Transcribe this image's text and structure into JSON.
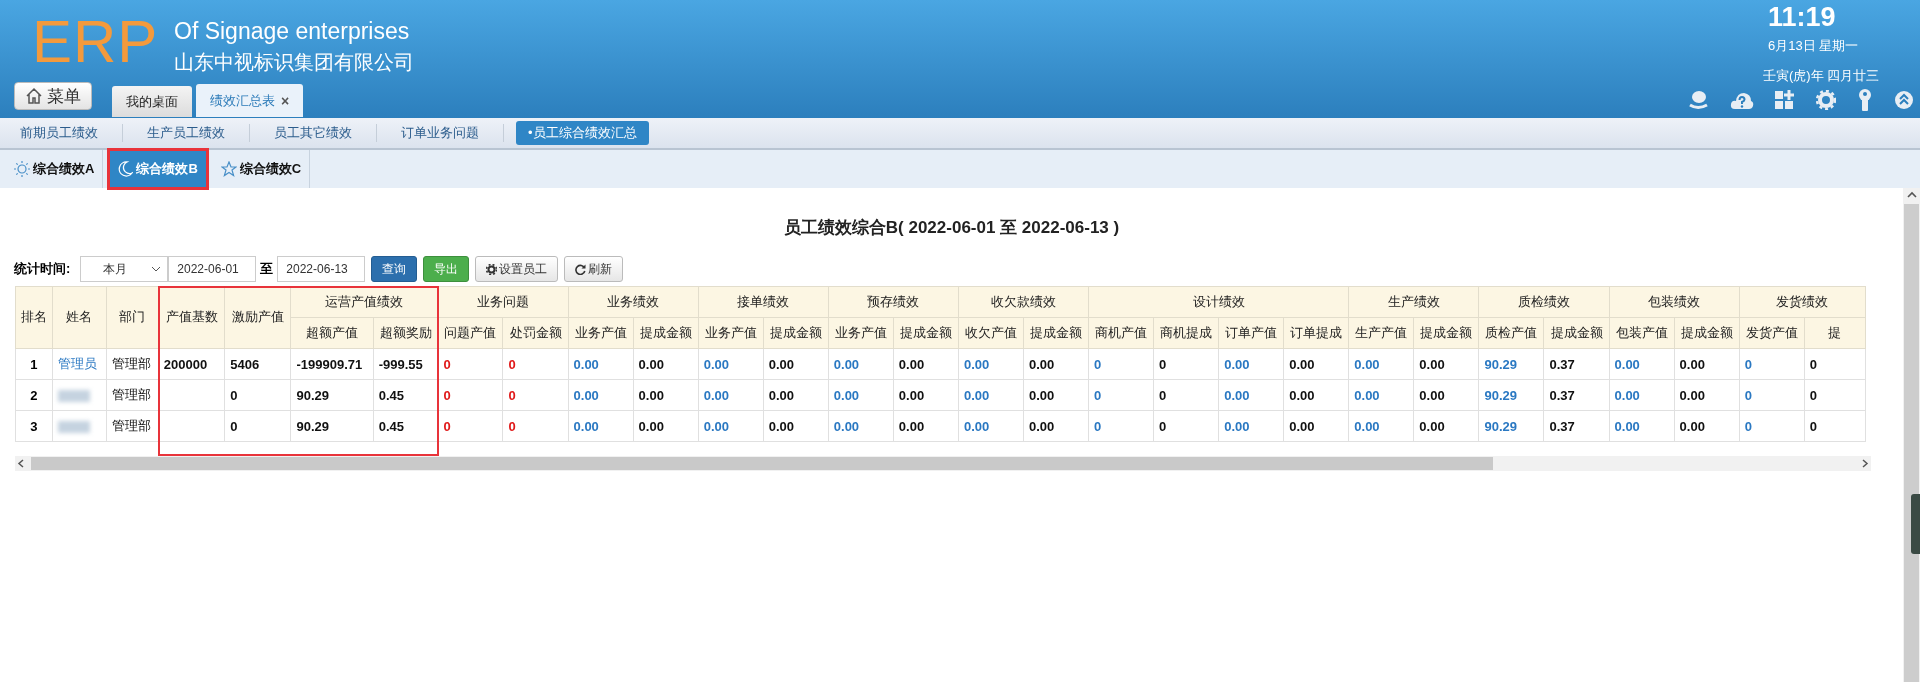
{
  "header": {
    "logo": "ERP",
    "title_en": "Of Signage enterprises",
    "title_cn": "山东中视标识集团有限公司",
    "time": "11:19",
    "date": "6月13日 星期一",
    "lunar_date": "壬寅(虎)年 四月廿三"
  },
  "menu_button": {
    "label": "菜单"
  },
  "page_tabs": [
    {
      "label": "我的桌面",
      "selected": false,
      "closable": false
    },
    {
      "label": "绩效汇总表",
      "selected": true,
      "closable": true,
      "close_label": "×"
    }
  ],
  "subnav": [
    {
      "label": "前期员工绩效",
      "selected": false
    },
    {
      "label": "生产员工绩效",
      "selected": false
    },
    {
      "label": "员工其它绩效",
      "selected": false
    },
    {
      "label": "订单业务问题",
      "selected": false
    },
    {
      "label": "•员工综合绩效汇总",
      "selected": true
    }
  ],
  "view_tabs": [
    {
      "label": "综合绩效A",
      "kind": "sun",
      "selected": false,
      "highlighted": false
    },
    {
      "label": "综合绩效B",
      "kind": "moon",
      "selected": true,
      "highlighted": true
    },
    {
      "label": "综合绩效C",
      "kind": "star",
      "selected": false,
      "highlighted": false
    }
  ],
  "report_title": "员工绩效综合B( 2022-06-01 至 2022-06-13 )",
  "filter": {
    "label": "统计时间:",
    "period": "本月",
    "date_from": "2022-06-01",
    "separator": "至",
    "date_to": "2022-06-13",
    "buttons": [
      {
        "label": "查询",
        "kind": "primary"
      },
      {
        "label": "导出",
        "kind": "success"
      },
      {
        "label": "设置员工",
        "kind": "gear"
      },
      {
        "label": "刷新",
        "kind": "refresh"
      }
    ]
  },
  "table": {
    "headers": [
      {
        "label": "排名",
        "highlighted": false
      },
      {
        "label": "姓名",
        "highlighted": false
      },
      {
        "label": "部门",
        "highlighted": false
      },
      {
        "label": "产值基数",
        "highlighted": true
      },
      {
        "label": "激励产值",
        "highlighted": true
      },
      {
        "label": "运营产值绩效",
        "highlighted": true,
        "children": [
          {
            "label": "超额产值",
            "kind": "figure"
          },
          {
            "label": "超额奖励",
            "kind": "figure"
          }
        ]
      },
      {
        "label": "业务问题",
        "highlighted": false,
        "children": [
          {
            "label": "问题产值",
            "kind": "alert"
          },
          {
            "label": "处罚金额",
            "kind": "alert"
          }
        ]
      },
      {
        "label": "业务绩效",
        "highlighted": false,
        "children": [
          {
            "label": "业务产值",
            "kind": "link"
          },
          {
            "label": "提成金额",
            "kind": "figure"
          }
        ]
      },
      {
        "label": "接单绩效",
        "highlighted": false,
        "children": [
          {
            "label": "业务产值",
            "kind": "link"
          },
          {
            "label": "提成金额",
            "kind": "figure"
          }
        ]
      },
      {
        "label": "预存绩效",
        "highlighted": false,
        "children": [
          {
            "label": "业务产值",
            "kind": "link"
          },
          {
            "label": "提成金额",
            "kind": "figure"
          }
        ]
      },
      {
        "label": "收欠款绩效",
        "highlighted": false,
        "children": [
          {
            "label": "收欠产值",
            "kind": "link"
          },
          {
            "label": "提成金额",
            "kind": "figure"
          }
        ]
      },
      {
        "label": "设计绩效",
        "highlighted": false,
        "children": [
          {
            "label": "商机产值",
            "kind": "link"
          },
          {
            "label": "商机提成",
            "kind": "figure"
          },
          {
            "label": "订单产值",
            "kind": "link"
          },
          {
            "label": "订单提成",
            "kind": "figure"
          }
        ]
      },
      {
        "label": "生产绩效",
        "highlighted": false,
        "children": [
          {
            "label": "生产产值",
            "kind": "link"
          },
          {
            "label": "提成金额",
            "kind": "figure"
          }
        ]
      },
      {
        "label": "质检绩效",
        "highlighted": false,
        "children": [
          {
            "label": "质检产值",
            "kind": "link"
          },
          {
            "label": "提成金额",
            "kind": "figure"
          }
        ]
      },
      {
        "label": "包装绩效",
        "highlighted": false,
        "children": [
          {
            "label": "包装产值",
            "kind": "link"
          },
          {
            "label": "提成金额",
            "kind": "figure"
          }
        ]
      },
      {
        "label": "发货绩效",
        "highlighted": false,
        "children": [
          {
            "label": "发货产值",
            "kind": "link"
          },
          {
            "label": "提",
            "kind": "figure"
          }
        ]
      }
    ],
    "rows": [
      {
        "rank": "1",
        "name": "管理员",
        "name_hidden": false,
        "department": "管理部",
        "base": "200000",
        "values": [
          "5406",
          "-199909.71",
          "-999.55",
          "0",
          "0",
          "0.00",
          "0.00",
          "0.00",
          "0.00",
          "0.00",
          "0.00",
          "0.00",
          "0.00",
          "0",
          "0",
          "0.00",
          "0.00",
          "0.00",
          "0.00",
          "90.29",
          "0.37",
          "0.00",
          "0.00",
          "0",
          "0"
        ]
      },
      {
        "rank": "2",
        "name_hidden": true,
        "department": "管理部",
        "values": [
          "0",
          "90.29",
          "0.45",
          "0",
          "0",
          "0.00",
          "0.00",
          "0.00",
          "0.00",
          "0.00",
          "0.00",
          "0.00",
          "0.00",
          "0",
          "0",
          "0.00",
          "0.00",
          "0.00",
          "0.00",
          "90.29",
          "0.37",
          "0.00",
          "0.00",
          "0",
          "0"
        ]
      },
      {
        "rank": "3",
        "name_hidden": true,
        "department": "管理部",
        "values": [
          "0",
          "90.29",
          "0.45",
          "0",
          "0",
          "0.00",
          "0.00",
          "0.00",
          "0.00",
          "0.00",
          "0.00",
          "0.00",
          "0.00",
          "0",
          "0",
          "0.00",
          "0.00",
          "0.00",
          "0.00",
          "90.29",
          "0.37",
          "0.00",
          "0.00",
          "0",
          "0"
        ]
      }
    ]
  }
}
